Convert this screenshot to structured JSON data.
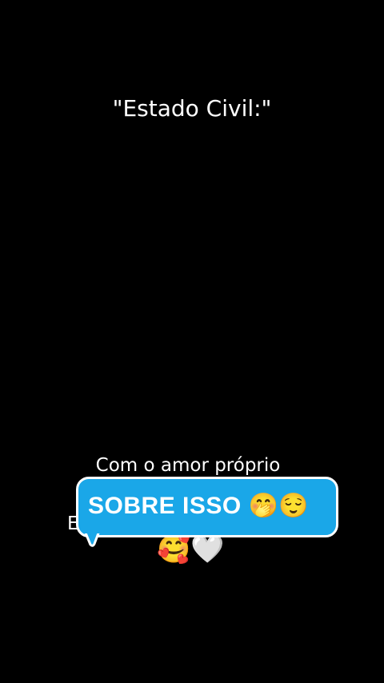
{
  "video": {
    "caption_top": "\"Estado Civil:\"",
    "caption_bottom_line1": "Com o amor próprio",
    "caption_bottom_line2_partial": "E",
    "caption_bottom_emojis": "🥰🤍"
  },
  "sticker": {
    "text": "SOBRE ISSO",
    "emojis": "🤭😌",
    "background_color": "#1aa7e8",
    "border_color": "#ffffff"
  }
}
